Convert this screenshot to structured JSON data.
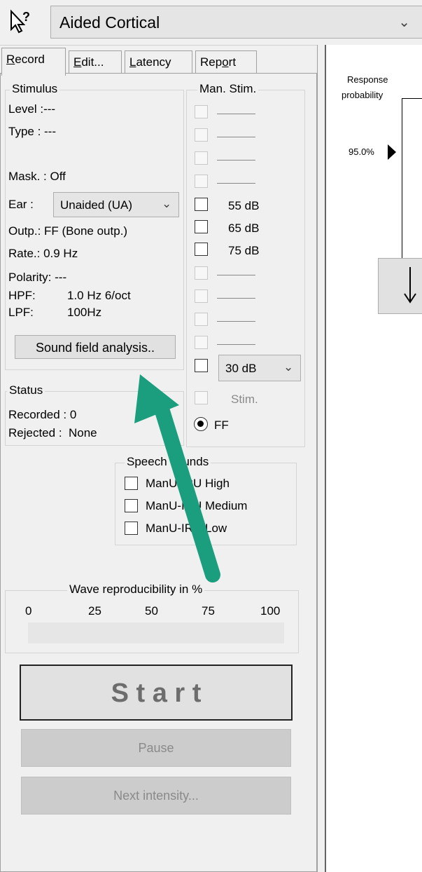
{
  "header": {
    "protocol": "Aided Cortical",
    "protocol_chevron": "chevron-down",
    "help_icon": "context-help-icon"
  },
  "tabs": [
    {
      "label": "Record",
      "underline": "R"
    },
    {
      "label": "Edit...",
      "underline": "E"
    },
    {
      "label": "Latency",
      "underline": "L"
    },
    {
      "label": "Report",
      "underline": "o"
    }
  ],
  "stimulus": {
    "legend": "Stimulus",
    "level": "Level :---",
    "type": "Type : ---",
    "mask": "Mask. : Off",
    "ear_label": "Ear :",
    "ear_value": "Unaided (UA)",
    "outp": "Outp.: FF (Bone outp.)",
    "rate": "Rate.: 0.9 Hz",
    "polarity": "Polarity: ---",
    "hpf_label": "HPF:",
    "hpf_value": "1.0 Hz 6/oct",
    "lpf_label": "LPF:",
    "lpf_value": "100Hz",
    "sound_field_button": "Sound field analysis.."
  },
  "man_stim": {
    "legend": "Man. Stim.",
    "items": [
      {
        "label": "",
        "enabled": false
      },
      {
        "label": "",
        "enabled": false
      },
      {
        "label": "",
        "enabled": false
      },
      {
        "label": "",
        "enabled": false
      },
      {
        "label": "55 dB",
        "enabled": true
      },
      {
        "label": "65 dB",
        "enabled": true
      },
      {
        "label": "75 dB",
        "enabled": true
      },
      {
        "label": "",
        "enabled": false
      },
      {
        "label": "",
        "enabled": false
      },
      {
        "label": "",
        "enabled": false
      },
      {
        "label": "",
        "enabled": false
      }
    ],
    "level_select": "30 dB",
    "stim_label": "Stim.",
    "ff_label": "FF"
  },
  "status": {
    "legend": "Status",
    "recorded": "Recorded : 0",
    "rejected": "Rejected :  None"
  },
  "speech_sounds": {
    "legend": "Speech sounds",
    "items": [
      "ManU-IRU High",
      "ManU-IRU Medium",
      "ManU-IRU Low"
    ]
  },
  "reproducibility": {
    "legend": "Wave reproducibility in %",
    "ticks": [
      "0",
      "25",
      "50",
      "75",
      "100"
    ],
    "value": 0
  },
  "buttons": {
    "start": "S t a r t",
    "pause": "Pause",
    "next_intensity": "Next intensity..."
  },
  "chart": {
    "title_line1": "Response",
    "title_line2": "probability",
    "marker_label": "95.0%"
  },
  "colors": {
    "annotation_arrow": "#1a9e7e"
  }
}
